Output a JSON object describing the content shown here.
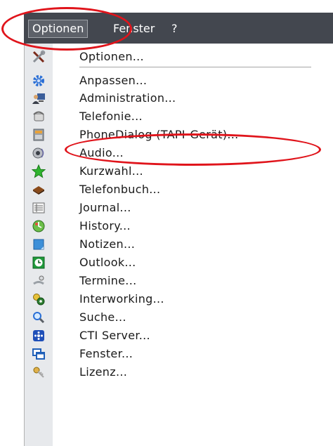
{
  "menubar": {
    "items": [
      {
        "label": "Optionen"
      },
      {
        "label": "Fenster"
      },
      {
        "label": "?"
      }
    ]
  },
  "menu": {
    "items": [
      {
        "label": "Optionen...",
        "icon": "tools-icon"
      },
      {
        "label": "Anpassen...",
        "icon": "gear-icon"
      },
      {
        "label": "Administration...",
        "icon": "admin-computer-icon"
      },
      {
        "label": "Telefonie...",
        "icon": "telephony-icon"
      },
      {
        "label": "PhoneDialog (TAPI-Gerät)...",
        "icon": "phone-device-icon"
      },
      {
        "label": "Audio...",
        "icon": "audio-icon"
      },
      {
        "label": "Kurzwahl...",
        "icon": "star-icon"
      },
      {
        "label": "Telefonbuch...",
        "icon": "book-icon"
      },
      {
        "label": "Journal...",
        "icon": "journal-list-icon"
      },
      {
        "label": "History...",
        "icon": "history-icon"
      },
      {
        "label": "Notizen...",
        "icon": "note-icon"
      },
      {
        "label": "Outlook...",
        "icon": "outlook-clock-icon"
      },
      {
        "label": "Termine...",
        "icon": "appointment-icon"
      },
      {
        "label": "Interworking...",
        "icon": "interworking-gears-icon"
      },
      {
        "label": "Suche...",
        "icon": "search-icon"
      },
      {
        "label": "CTI Server...",
        "icon": "cti-server-icon"
      },
      {
        "label": "Fenster...",
        "icon": "windows-icon"
      },
      {
        "label": "Lizenz...",
        "icon": "license-key-icon"
      }
    ]
  },
  "colors": {
    "menubar_bg": "#43474f",
    "highlight_ellipse": "#e0141b",
    "icon_strip": "#e7e9ec"
  }
}
